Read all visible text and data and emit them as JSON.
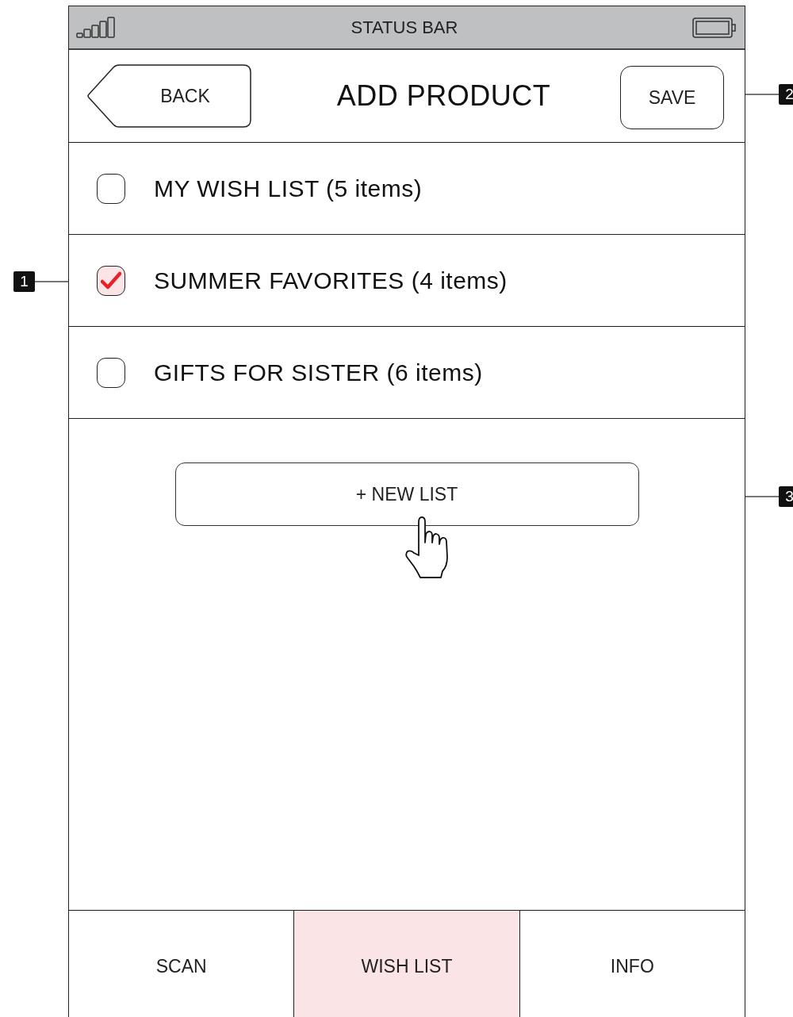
{
  "status_bar": {
    "title": "STATUS BAR"
  },
  "header": {
    "back": "BACK",
    "title": "ADD PRODUCT",
    "save": "SAVE"
  },
  "lists": [
    {
      "label": "MY WISH LIST (5 items)",
      "checked": false
    },
    {
      "label": "SUMMER FAVORITES (4 items)",
      "checked": true
    },
    {
      "label": "GIFTS FOR SISTER (6 items)",
      "checked": false
    }
  ],
  "new_list_button": "+ NEW LIST",
  "tabs": [
    {
      "label": "SCAN",
      "selected": false
    },
    {
      "label": "WISH LIST",
      "selected": true
    },
    {
      "label": "INFO",
      "selected": false
    }
  ],
  "annotations": [
    {
      "number": "1"
    },
    {
      "number": "2"
    },
    {
      "number": "3"
    }
  ]
}
